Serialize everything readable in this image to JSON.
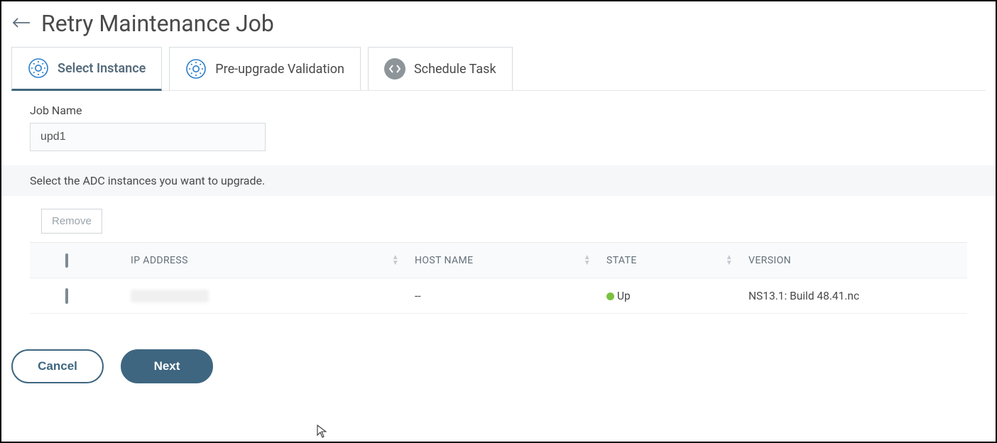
{
  "header": {
    "title": "Retry Maintenance Job"
  },
  "tabs": [
    {
      "label": "Select Instance"
    },
    {
      "label": "Pre-upgrade Validation"
    },
    {
      "label": "Schedule Task"
    }
  ],
  "form": {
    "job_name_label": "Job Name",
    "job_name_value": "upd1",
    "hint": "Select the ADC instances you want to upgrade."
  },
  "toolbar": {
    "remove_label": "Remove"
  },
  "table": {
    "columns": {
      "ip": "IP ADDRESS",
      "host": "HOST NAME",
      "state": "STATE",
      "version": "VERSION"
    },
    "rows": [
      {
        "ip": "",
        "host": "--",
        "state": "Up",
        "version": "NS13.1: Build 48.41.nc"
      }
    ]
  },
  "footer": {
    "cancel": "Cancel",
    "next": "Next"
  }
}
